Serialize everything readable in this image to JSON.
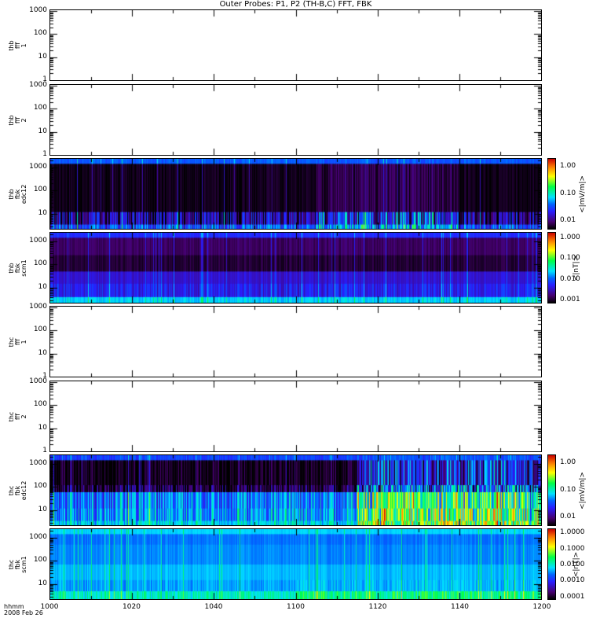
{
  "title": "Outer Probes: P1, P2 (TH-B,C) FFT, FBK",
  "footer": {
    "time_label": "hhmm",
    "date": "2008 Feb 26"
  },
  "chart_data": {
    "type": "heatmap",
    "title": "Outer Probes: P1, P2 (TH-B,C) FFT, FBK",
    "x_tick_labels": [
      "1000",
      "1020",
      "1040",
      "1100",
      "1120",
      "1140",
      "1200"
    ],
    "x_range_minutes": [
      0,
      120
    ],
    "panels": [
      {
        "label": [
          "thb",
          "fff",
          "1"
        ],
        "ylim": [
          1,
          1100
        ],
        "y_ticks": [
          "1000",
          "100",
          "10",
          "1"
        ],
        "empty": true
      },
      {
        "label": [
          "thb",
          "fff",
          "2"
        ],
        "ylim": [
          1,
          1100
        ],
        "y_ticks": [
          "1000",
          "100",
          "10",
          "1"
        ],
        "empty": true
      },
      {
        "label": [
          "thb",
          "fbk",
          "edc12"
        ],
        "ylim": [
          2.3,
          2300
        ],
        "y_ticks": [
          "1000",
          "100",
          "10"
        ],
        "colorbar": {
          "ticks": [
            "1.00",
            "0.10",
            "0.01"
          ],
          "unit": "<|mV/m|>",
          "range": [
            0.005,
            2
          ]
        },
        "bands": [
          [
            1400,
            2300,
            0.33,
            0.04,
            0,
            0
          ],
          [
            12,
            1400,
            0.02,
            0.03,
            0.1,
            0.02
          ],
          [
            3.5,
            12,
            0.12,
            0.2,
            0.3,
            0.1
          ],
          [
            2.3,
            3.5,
            0.3,
            0.15,
            0.25,
            0.1
          ]
        ],
        "active": [
          65,
          100
        ]
      },
      {
        "label": [
          "thb",
          "fbk",
          "scm1"
        ],
        "ylim": [
          2.3,
          2300
        ],
        "y_ticks": [
          "1000",
          "100",
          "10"
        ],
        "colorbar": {
          "ticks": [
            "1.000",
            "0.100",
            "0.010",
            "0.001"
          ],
          "unit": "<|nT|>",
          "range": [
            0.0007,
            2
          ]
        },
        "bands": [
          [
            1400,
            2300,
            0.27,
            0.03,
            0,
            0
          ],
          [
            250,
            1400,
            0.09,
            0.03,
            0,
            0
          ],
          [
            50,
            250,
            0.05,
            0.03,
            0,
            0
          ],
          [
            15,
            50,
            0.2,
            0.04,
            0,
            0
          ],
          [
            4,
            15,
            0.24,
            0.08,
            0,
            0.02
          ],
          [
            2.3,
            4,
            0.44,
            0.05,
            0,
            0
          ]
        ],
        "active": [
          90,
          120
        ]
      },
      {
        "label": [
          "thc",
          "fff",
          "1"
        ],
        "ylim": [
          1,
          1100
        ],
        "y_ticks": [
          "1000",
          "100",
          "10",
          "1"
        ],
        "empty": true
      },
      {
        "label": [
          "thc",
          "fff",
          "2"
        ],
        "ylim": [
          1,
          1100
        ],
        "y_ticks": [
          "1000",
          "100",
          "10",
          "1"
        ],
        "empty": true
      },
      {
        "label": [
          "thc",
          "fbk",
          "edc12"
        ],
        "ylim": [
          2.3,
          2300
        ],
        "y_ticks": [
          "1000",
          "100",
          "10"
        ],
        "colorbar": {
          "ticks": [
            "1.00",
            "0.10",
            "0.01"
          ],
          "unit": "<|mV/m|>",
          "range": [
            0.005,
            2
          ]
        },
        "bands": [
          [
            1400,
            2300,
            0.3,
            0.05,
            0.05,
            0.05
          ],
          [
            120,
            1400,
            0.02,
            0.05,
            0.45,
            0.1
          ],
          [
            60,
            120,
            0.05,
            0.15,
            0.5,
            0.1
          ],
          [
            12,
            60,
            0.35,
            0.15,
            0.45,
            0.1
          ],
          [
            3.5,
            12,
            0.38,
            0.15,
            0.45,
            0.1
          ],
          [
            2.3,
            3.5,
            0.45,
            0.1,
            0.4,
            0.1
          ]
        ],
        "active": [
          75,
          120
        ]
      },
      {
        "label": [
          "thc",
          "fbk",
          "scm1"
        ],
        "ylim": [
          2.3,
          2300
        ],
        "y_ticks": [
          "1000",
          "100",
          "10"
        ],
        "colorbar": {
          "ticks": [
            "1.0000",
            "0.1000",
            "0.0100",
            "0.0010",
            "0.0001"
          ],
          "unit": "<|nT|>",
          "range": [
            7e-05,
            2
          ]
        },
        "bands": [
          [
            1400,
            2300,
            0.44,
            0.02,
            0,
            0
          ],
          [
            500,
            1400,
            0.36,
            0.03,
            0,
            0
          ],
          [
            70,
            500,
            0.38,
            0.03,
            0,
            0
          ],
          [
            15,
            70,
            0.42,
            0.03,
            0,
            0
          ],
          [
            5,
            15,
            0.4,
            0.05,
            0.05,
            0
          ],
          [
            2.3,
            5,
            0.5,
            0.08,
            0.12,
            0
          ]
        ],
        "active": [
          60,
          120
        ]
      }
    ]
  }
}
